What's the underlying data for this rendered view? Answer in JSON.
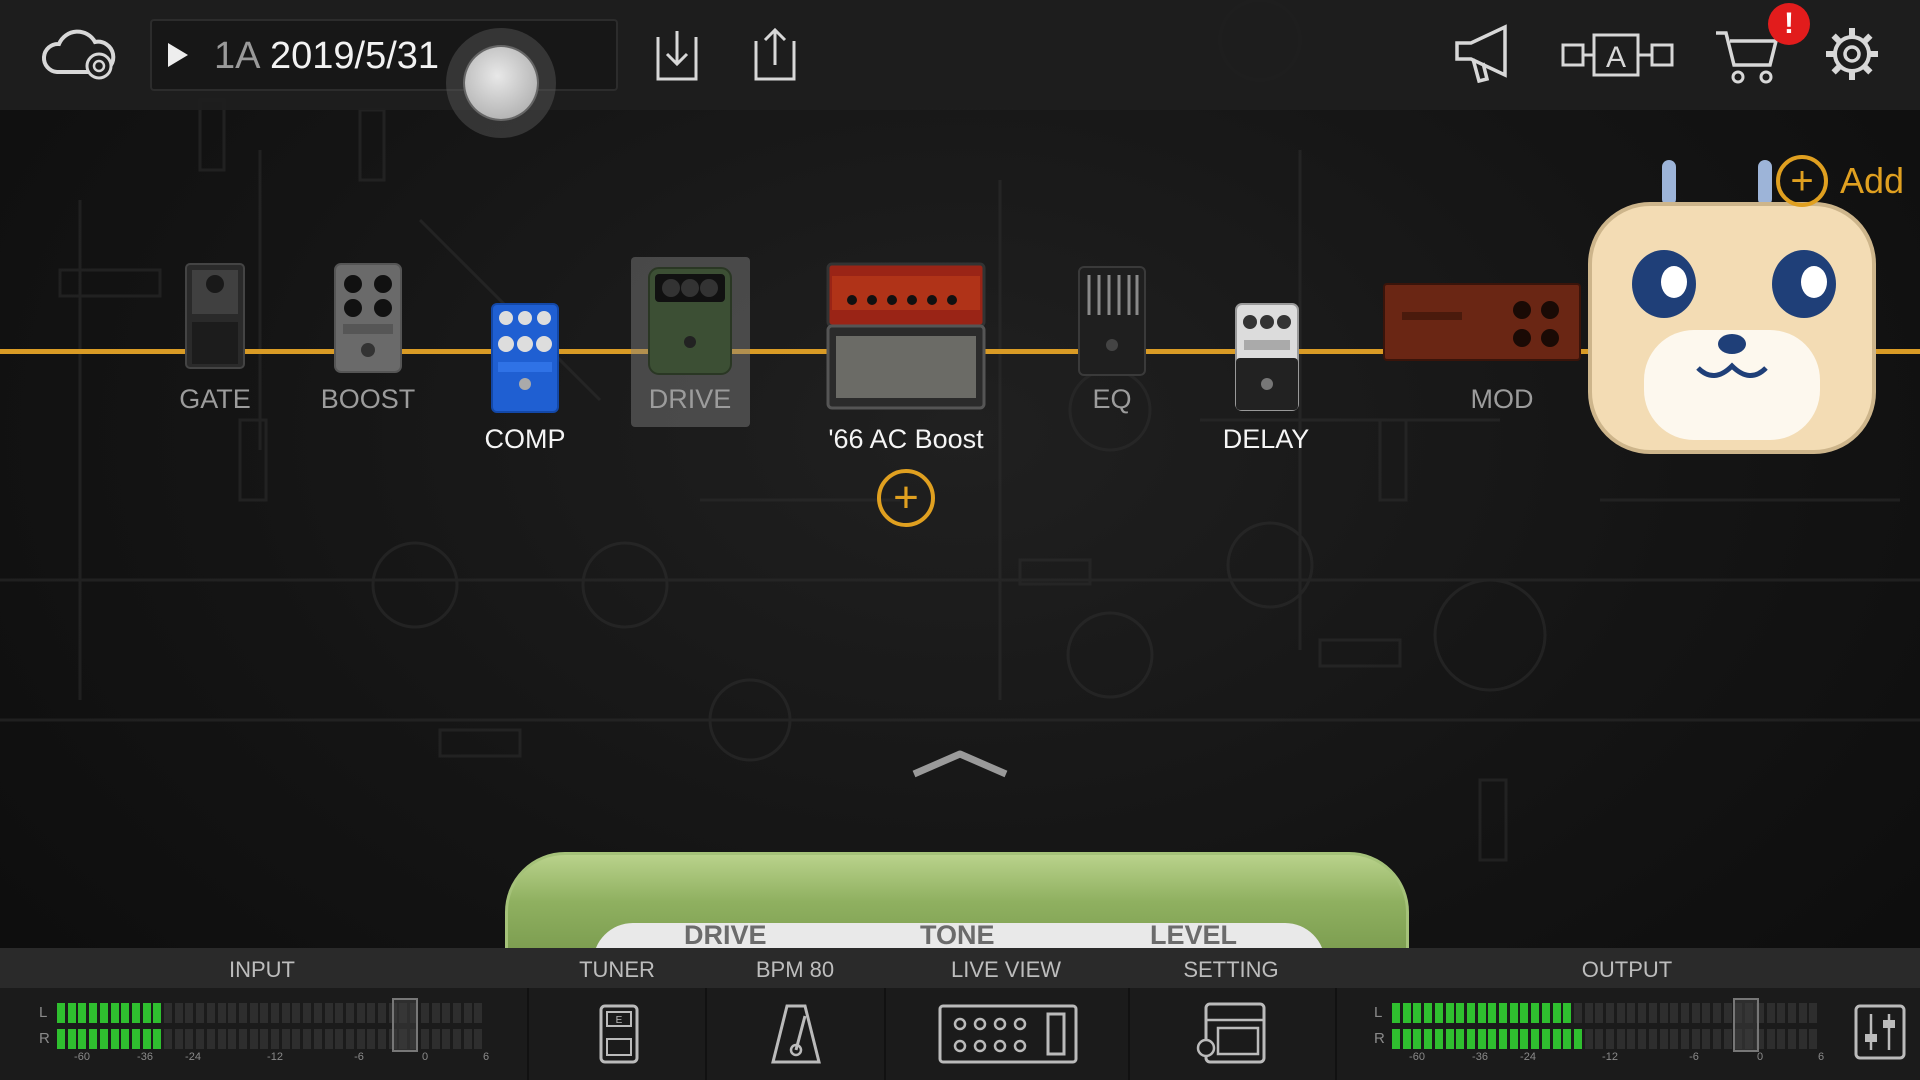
{
  "topbar": {
    "preset_number": "1A",
    "preset_name": "2019/5/31",
    "alert_badge": "!",
    "icons": [
      "cloud-sync-icon",
      "play-icon",
      "download-icon",
      "share-icon",
      "megaphone-icon",
      "ab-compare-icon",
      "cart-icon",
      "settings-icon"
    ]
  },
  "add_button": {
    "label": "Add"
  },
  "chain": {
    "effects": [
      {
        "label": "GATE",
        "state": "bypassed"
      },
      {
        "label": "BOOST",
        "state": "bypassed"
      },
      {
        "label": "COMP",
        "state": "on"
      },
      {
        "label": "DRIVE",
        "state": "bypassed-selected"
      },
      {
        "label": "'66 AC Boost",
        "state": "on"
      },
      {
        "label": "EQ",
        "state": "bypassed"
      },
      {
        "label": "DELAY",
        "state": "on"
      },
      {
        "label": "MOD",
        "state": "bypassed"
      }
    ],
    "cable_color": "#d99b25"
  },
  "pedal_view": {
    "knobs": [
      "DRIVE",
      "TONE",
      "LEVEL"
    ],
    "color": "#8fb060"
  },
  "bottombar": {
    "sections": [
      "INPUT",
      "TUNER",
      "BPM 80",
      "LIVE VIEW",
      "SETTING",
      "OUTPUT"
    ],
    "meter_scale": [
      "-60",
      "-36",
      "-24",
      "-12",
      "-6",
      "0",
      "6"
    ],
    "channels": [
      "L",
      "R"
    ],
    "input_level": {
      "L": 0.25,
      "R": 0.25
    },
    "output_level": {
      "L": 0.42,
      "R": 0.45
    }
  }
}
